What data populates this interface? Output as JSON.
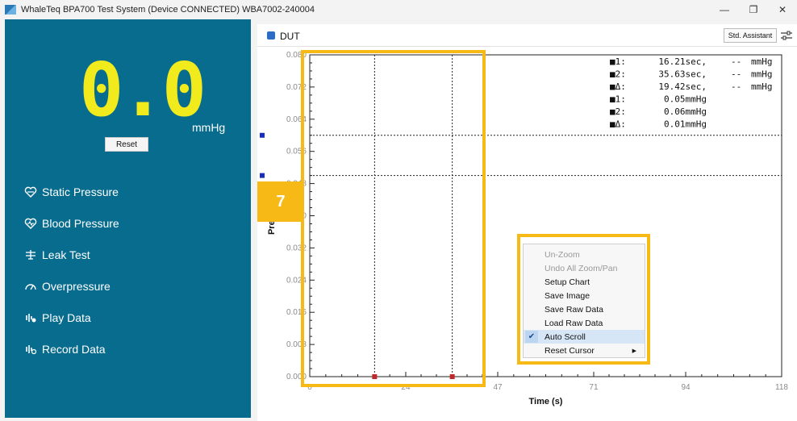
{
  "window": {
    "title": "WhaleTeq BPA700 Test System (Device CONNECTED)    WBA7002-240004",
    "minimize": "—",
    "restore": "❐",
    "close": "✕"
  },
  "sidebar": {
    "value": "0.0",
    "unit": "mmHg",
    "reset_label": "Reset",
    "nav": [
      {
        "label": "Static Pressure",
        "icon": "heart-icon"
      },
      {
        "label": "Blood Pressure",
        "icon": "heart-pulse-icon"
      },
      {
        "label": "Leak Test",
        "icon": "leak-icon"
      },
      {
        "label": "Overpressure",
        "icon": "gauge-icon"
      },
      {
        "label": "Play Data",
        "icon": "waveform-icon"
      },
      {
        "label": "Record Data",
        "icon": "waveform-record-icon"
      }
    ]
  },
  "main": {
    "dut_label": "DUT",
    "std_assistant_label": "Std. Assistant"
  },
  "legend": [
    {
      "marker": "■1:",
      "value": "16.21sec,",
      "dash": "--",
      "unit": "mmHg",
      "color": "#c0282a"
    },
    {
      "marker": "■2:",
      "value": "35.63sec,",
      "dash": "--",
      "unit": "mmHg",
      "color": "#c0282a"
    },
    {
      "marker": "■Δ:",
      "value": "19.42sec,",
      "dash": "--",
      "unit": "mmHg",
      "color": "#c0282a"
    },
    {
      "marker": "■1:",
      "value": "0.05mmHg",
      "dash": "",
      "unit": "",
      "color": "#1a2fb0"
    },
    {
      "marker": "■2:",
      "value": "0.06mmHg",
      "dash": "",
      "unit": "",
      "color": "#1a2fb0"
    },
    {
      "marker": "■Δ:",
      "value": "0.01mmHg",
      "dash": "",
      "unit": "",
      "color": "#1a2fb0"
    }
  ],
  "context_menu": [
    {
      "label": "Un-Zoom",
      "disabled": true
    },
    {
      "label": "Undo All Zoom/Pan",
      "disabled": true
    },
    {
      "label": "Setup Chart"
    },
    {
      "label": "Save Image"
    },
    {
      "label": "Save Raw Data"
    },
    {
      "label": "Load Raw Data"
    },
    {
      "label": "Auto Scroll",
      "checked": true
    },
    {
      "label": "Reset Cursor",
      "submenu": true
    }
  ],
  "badge": "7",
  "chart_data": {
    "type": "line",
    "xlabel": "Time (s)",
    "ylabel": "Pressure",
    "xlim": [
      0,
      118
    ],
    "ylim": [
      0,
      0.08
    ],
    "x_ticks": [
      "0",
      "24",
      "47",
      "71",
      "94",
      "118"
    ],
    "y_ticks": [
      "0.000",
      "0.008",
      "0.016",
      "0.024",
      "0.032",
      "0.040",
      "0.048",
      "0.056",
      "0.064",
      "0.072",
      "0.080"
    ],
    "cursors_x": [
      16.21,
      35.63
    ],
    "cursors_y": [
      0.05,
      0.06
    ],
    "series": []
  }
}
